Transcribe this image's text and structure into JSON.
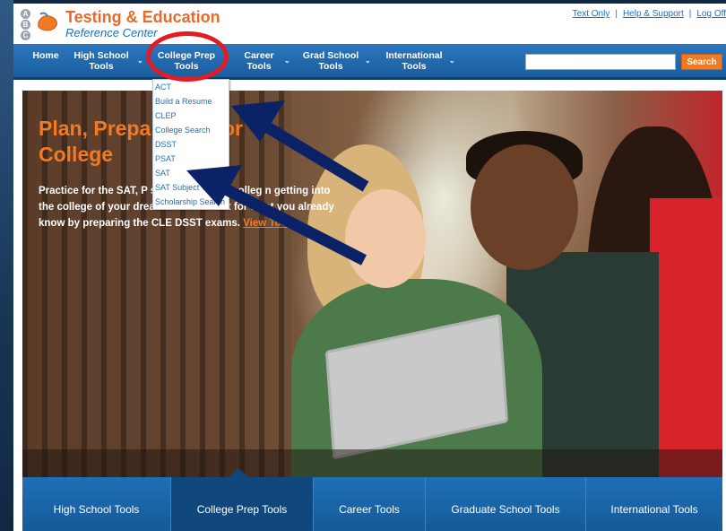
{
  "header": {
    "logo_letters": [
      "A",
      "B",
      "C"
    ],
    "title": "Testing & Education",
    "subtitle": "Reference Center",
    "links": [
      "Text Only",
      "Help & Support",
      "Log Off"
    ],
    "separator": "|"
  },
  "nav": {
    "items": [
      {
        "line1": "Home",
        "line2": ""
      },
      {
        "line1": "High School",
        "line2": "Tools"
      },
      {
        "line1": "College Prep",
        "line2": "Tools"
      },
      {
        "line1": "Career",
        "line2": "Tools"
      },
      {
        "line1": "Grad School",
        "line2": "Tools"
      },
      {
        "line1": "International",
        "line2": "Tools"
      }
    ],
    "dropdown_chevron": "⌄",
    "search_placeholder": "",
    "search_button": "Search"
  },
  "dropdown": {
    "items": [
      "ACT",
      "Build a Resume",
      "CLEP",
      "College Search",
      "DSST",
      "PSAT",
      "SAT",
      "SAT Subject Tests",
      "Scholarship Search"
    ]
  },
  "hero": {
    "title": "Plan, Prepare for College",
    "title_line1": "Plan, Prepa",
    "title_line1_tail": "for",
    "title_line2": "College",
    "text": "Practice for the SAT, P scholarship and colleg n getting into the college of your dreams. Then credit for what you already know by preparing the CLE DSST exams.",
    "link": "View Tools"
  },
  "bottom_tabs": {
    "items": [
      "High School Tools",
      "College Prep Tools",
      "Career Tools",
      "Graduate School Tools",
      "International Tools"
    ],
    "active": "College Prep Tools"
  },
  "colors": {
    "brand_orange": "#e8692a",
    "brand_blue": "#1e6fb8",
    "nav_blue": "#1a5e9e",
    "annotation_red": "#e31c23",
    "annotation_arrow": "#0b2366"
  }
}
